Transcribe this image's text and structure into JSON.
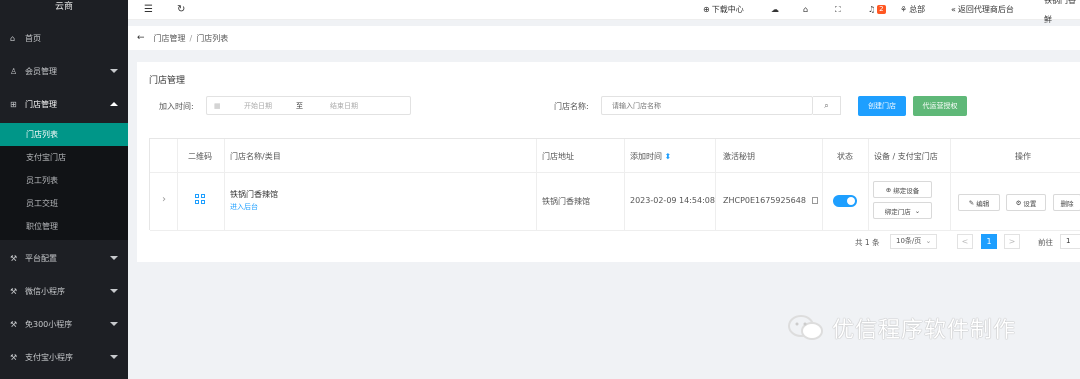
{
  "sidebar": {
    "brand": "云商",
    "items": [
      {
        "label": "首页",
        "icon": "home-icon",
        "glyph": "⌂"
      },
      {
        "label": "会员管理",
        "icon": "user-icon",
        "glyph": "♙"
      },
      {
        "label": "门店管理",
        "icon": "store-icon",
        "glyph": "⊞"
      },
      {
        "label": "平台配置",
        "icon": "config-icon",
        "glyph": "⚒"
      },
      {
        "label": "微信小程序",
        "icon": "wechat-icon",
        "glyph": "⚒"
      },
      {
        "label": "免300小程序",
        "icon": "miniapp-icon",
        "glyph": "⚒"
      },
      {
        "label": "支付宝小程序",
        "icon": "alipay-icon",
        "glyph": "⚒"
      }
    ],
    "submenu": [
      "门店列表",
      "支付宝门店",
      "员工列表",
      "员工交班",
      "职位管理"
    ]
  },
  "header": {
    "menu_glyph": "☰",
    "refresh_glyph": "↻",
    "download": "下载中心",
    "notice_count": "2",
    "hq": "总部",
    "back_agent": "返回代理商后台",
    "store_name": "铁锅门香鲜"
  },
  "breadcrumb": {
    "back_glyph": "←",
    "parent": "门店管理",
    "sep": "/",
    "current": "门店列表"
  },
  "card": {
    "title": "门店管理",
    "filter": {
      "date_label": "加入时间:",
      "start_placeholder": "开始日期",
      "to": "至",
      "end_placeholder": "结束日期",
      "name_label": "门店名称:",
      "name_placeholder": "请输入门店名称",
      "create_button": "创建门店",
      "auth_button": "代运营授权"
    },
    "table": {
      "headers": [
        "二维码",
        "门店名称/类目",
        "门店地址",
        "添加时间",
        "激活秘钥",
        "状态",
        "设备 / 支付宝门店",
        "操作"
      ],
      "sort_glyph": "⬍",
      "row": {
        "expand_glyph": "›",
        "name": "铁锅门香辣馆",
        "enter_link": "进入后台",
        "address": "铁锅门香辣馆",
        "added_time": "2023-02-09 14:54:08",
        "activation_key": "ZHCP0E1675925648",
        "status_on": true,
        "bind_device": "绑定设备",
        "bind_store": "绑定门店",
        "edit": "编辑",
        "settings": "设置",
        "delete": "删除"
      }
    },
    "pagination": {
      "total": "共 1 条",
      "page_size": "10条/页",
      "prev": "<",
      "current": "1",
      "next": ">",
      "goto_label": "前往",
      "goto_value": "1"
    }
  },
  "watermark": "优信程序软件制作",
  "colors": {
    "sidebar_bg": "#1d1f24",
    "active_green": "#009688",
    "primary_blue": "#1e9fff",
    "success_green": "#5fb878",
    "badge_red": "#ff5722"
  }
}
